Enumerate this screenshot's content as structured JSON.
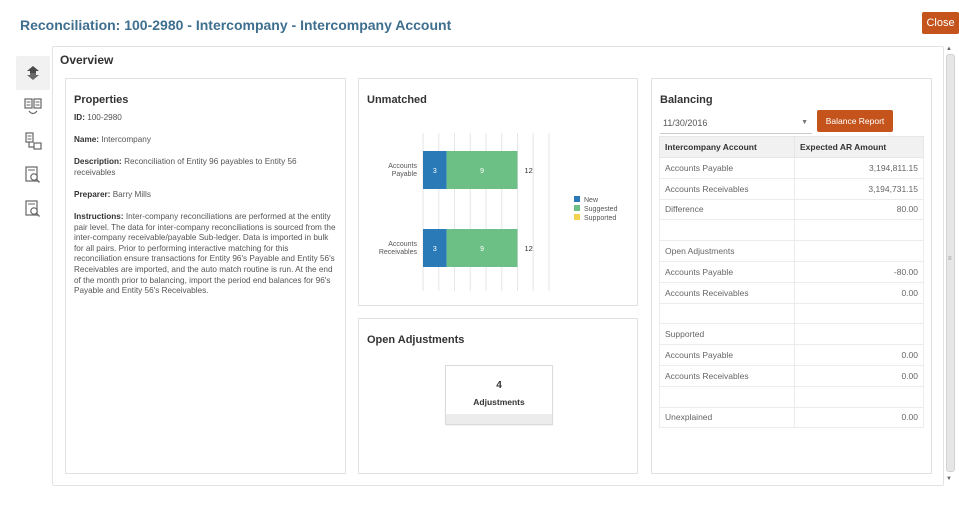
{
  "header": {
    "title": "Reconciliation: 100-2980 - Intercompany - Intercompany Account",
    "close_label": "Close"
  },
  "rail": {
    "icons": [
      "refresh-arrows-icon",
      "compare-docs-icon",
      "document-tree-icon",
      "search-document-icon",
      "search-document-alt-icon"
    ]
  },
  "overview": {
    "title": "Overview"
  },
  "properties": {
    "title": "Properties",
    "id_label": "ID:",
    "id_value": "100-2980",
    "name_label": "Name:",
    "name_value": "Intercompany",
    "description_label": "Description:",
    "description_value": "Reconciliation of Entity 96 payables to Entity 56 receivables",
    "preparer_label": "Preparer:",
    "preparer_value": "Barry Mills",
    "instructions_label": "Instructions:",
    "instructions_value": "Inter-company reconciliations are performed at the entity pair level. The data for inter-company reconciliations is sourced from the inter-company receivable/payable Sub-ledger. Data is imported in bulk for all pairs. Prior to performing interactive matching for this reconciliation ensure transactions for Entity 96's Payable and Entity 56's Receivables are imported, and the auto match routine is run. At the end of the month prior to balancing, import the period end balances for 96's Payable and Entity 56's Receivables."
  },
  "unmatched": {
    "title": "Unmatched",
    "colors": {
      "new": "#2a7ab8",
      "suggested": "#6cc085",
      "supported": "#f2d24f"
    }
  },
  "chart_data": {
    "type": "bar",
    "orientation": "horizontal",
    "stacked": true,
    "categories": [
      "Accounts Payable",
      "Accounts Receivables"
    ],
    "category_lines": [
      [
        "Accounts",
        "Payable"
      ],
      [
        "Accounts",
        "Receivables"
      ]
    ],
    "series": [
      {
        "name": "New",
        "values": [
          3,
          3
        ],
        "color": "#2a7ab8"
      },
      {
        "name": "Suggested",
        "values": [
          9,
          9
        ],
        "color": "#6cc085"
      },
      {
        "name": "Supported",
        "values": [
          0,
          0
        ],
        "color": "#f2d24f"
      }
    ],
    "totals": [
      12,
      12
    ],
    "xlim": [
      0,
      16
    ],
    "grid": true,
    "legend": "right"
  },
  "open_adjustments": {
    "title": "Open Adjustments",
    "count": "4",
    "label": "Adjustments"
  },
  "balancing": {
    "title": "Balancing",
    "date": "11/30/2016",
    "report_button": "Balance Report",
    "columns": [
      "Intercompany Account",
      "Expected AR Amount"
    ],
    "rows": [
      {
        "name": "Accounts Payable",
        "amount": "3,194,811.15"
      },
      {
        "name": "Accounts Receivables",
        "amount": "3,194,731.15"
      },
      {
        "name": "Difference",
        "amount": "80.00"
      },
      {
        "name": "",
        "amount": ""
      },
      {
        "name": "Open Adjustments",
        "amount": ""
      },
      {
        "name": "Accounts Payable",
        "amount": "-80.00"
      },
      {
        "name": "Accounts Receivables",
        "amount": "0.00"
      },
      {
        "name": "",
        "amount": ""
      },
      {
        "name": "Supported",
        "amount": ""
      },
      {
        "name": "Accounts Payable",
        "amount": "0.00"
      },
      {
        "name": "Accounts Receivables",
        "amount": "0.00"
      },
      {
        "name": "",
        "amount": ""
      },
      {
        "name": "Unexplained",
        "amount": "0.00"
      }
    ]
  }
}
